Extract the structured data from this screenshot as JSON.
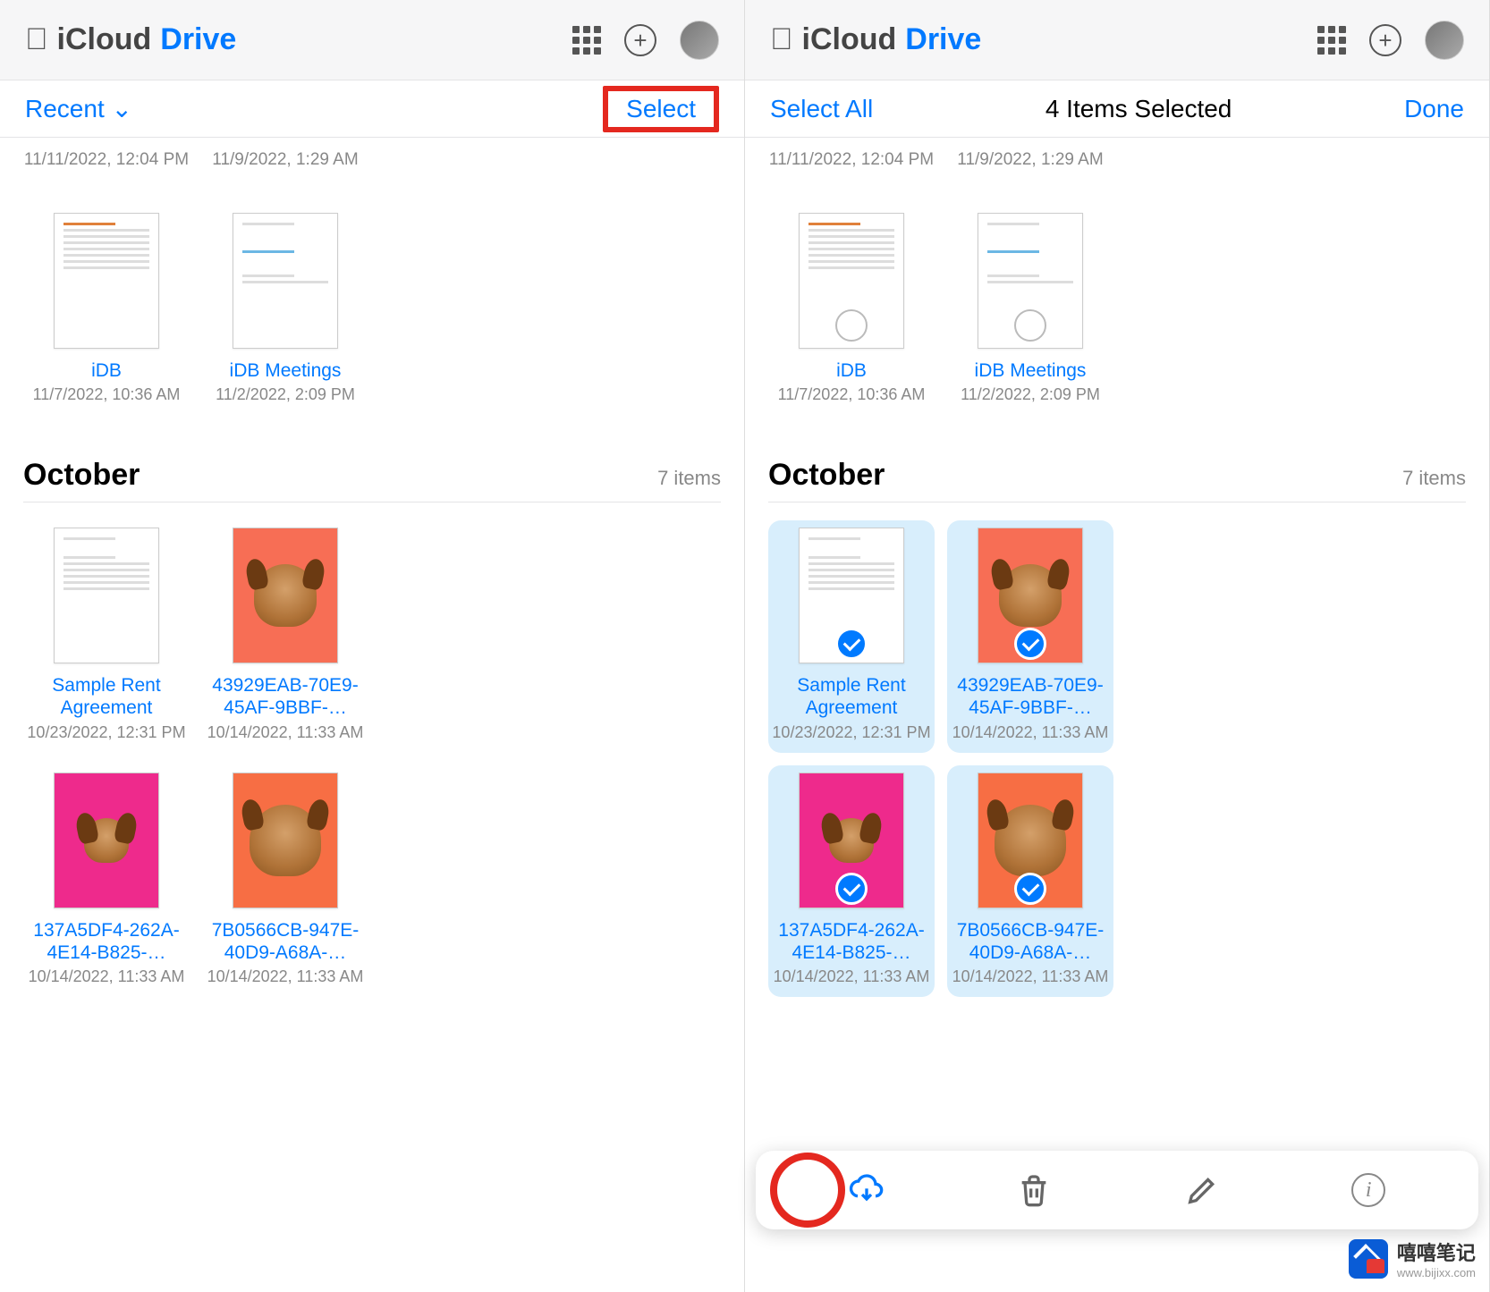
{
  "header": {
    "icloud": "iCloud",
    "drive": "Drive"
  },
  "left": {
    "subheader_left": "Recent",
    "subheader_right": "Select",
    "top_dates": [
      "11/11/2022, 12:04 PM",
      "11/9/2022, 1:29 AM"
    ],
    "files_row1": [
      {
        "name": "iDB",
        "date": "11/7/2022, 10:36 AM",
        "type": "doc"
      },
      {
        "name": "iDB Meetings",
        "date": "11/2/2022, 2:09 PM",
        "type": "doc"
      }
    ],
    "section": {
      "title": "October",
      "count": "7 items"
    },
    "files_row2": [
      {
        "name": "Sample Rent Agreement",
        "date": "10/23/2022, 12:31 PM",
        "type": "doc"
      },
      {
        "name": "43929EAB-70E9-45AF-9BBF-…",
        "date": "10/14/2022, 11:33 AM",
        "type": "photo",
        "bg": "bg-coral"
      }
    ],
    "files_row3": [
      {
        "name": "137A5DF4-262A-4E14-B825-…",
        "date": "10/14/2022, 11:33 AM",
        "type": "photo",
        "bg": "bg-hotpink"
      },
      {
        "name": "7B0566CB-947E-40D9-A68A-…",
        "date": "10/14/2022, 11:33 AM",
        "type": "photo",
        "bg": "bg-orange"
      }
    ]
  },
  "right": {
    "subheader_left": "Select All",
    "subheader_center": "4 Items Selected",
    "subheader_right": "Done",
    "top_dates": [
      "11/11/2022, 12:04 PM",
      "11/9/2022, 1:29 AM"
    ],
    "files_row1": [
      {
        "name": "iDB",
        "date": "11/7/2022, 10:36 AM",
        "type": "doc",
        "selected": false,
        "circle": true
      },
      {
        "name": "iDB Meetings",
        "date": "11/2/2022, 2:09 PM",
        "type": "doc",
        "selected": false,
        "circle": true
      }
    ],
    "section": {
      "title": "October",
      "count": "7 items"
    },
    "files_row2": [
      {
        "name": "Sample Rent Agreement",
        "date": "10/23/2022, 12:31 PM",
        "type": "doc",
        "selected": true
      },
      {
        "name": "43929EAB-70E9-45AF-9BBF-…",
        "date": "10/14/2022, 11:33 AM",
        "type": "photo",
        "bg": "bg-coral",
        "selected": true
      }
    ],
    "files_row3": [
      {
        "name": "137A5DF4-262A-4E14-B825-…",
        "date": "10/14/2022, 11:33 AM",
        "type": "photo",
        "bg": "bg-hotpink",
        "selected": true
      },
      {
        "name": "7B0566CB-947E-40D9-A68A-…",
        "date": "10/14/2022, 11:33 AM",
        "type": "photo",
        "bg": "bg-orange",
        "selected": true
      }
    ]
  },
  "watermark": {
    "big": "嘻嘻笔记",
    "small": "www.bijixx.com"
  }
}
